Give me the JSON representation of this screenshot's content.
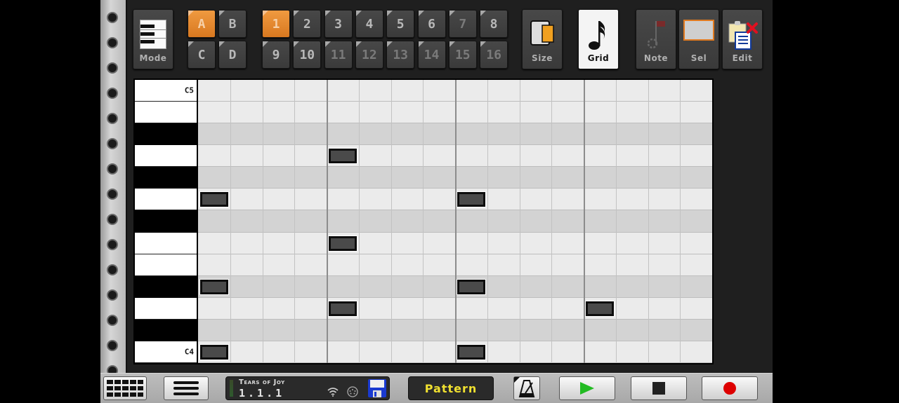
{
  "toolbar": {
    "mode": {
      "label": "Mode",
      "icon": "piano-keys-icon"
    },
    "banks": [
      {
        "label": "A",
        "active": true
      },
      {
        "label": "B",
        "active": false
      },
      {
        "label": "C",
        "active": false
      },
      {
        "label": "D",
        "active": false
      }
    ],
    "patterns": [
      {
        "label": "1",
        "active": true
      },
      {
        "label": "2"
      },
      {
        "label": "3"
      },
      {
        "label": "4"
      },
      {
        "label": "5"
      },
      {
        "label": "6"
      },
      {
        "label": "7",
        "dim": true
      },
      {
        "label": "8"
      },
      {
        "label": "9"
      },
      {
        "label": "10"
      },
      {
        "label": "11",
        "dim": true
      },
      {
        "label": "12",
        "dim": true
      },
      {
        "label": "13",
        "dim": true
      },
      {
        "label": "14",
        "dim": true
      },
      {
        "label": "15",
        "dim": true
      },
      {
        "label": "16",
        "dim": true
      }
    ],
    "tools": [
      {
        "label": "Size",
        "icon": "size-icon",
        "active": false
      },
      {
        "label": "Grid",
        "icon": "eighth-note-icon",
        "active": true
      },
      {
        "label": "Note",
        "icon": "note-flag-icon",
        "active": false
      },
      {
        "label": "Sel",
        "icon": "selection-rect-icon",
        "active": false
      },
      {
        "label": "Edit",
        "icon": "clipboard-edit-icon",
        "active": false
      }
    ]
  },
  "piano_roll": {
    "top_label": "C5",
    "bottom_label": "C4",
    "rows": [
      {
        "note": "C5",
        "type": "white"
      },
      {
        "note": "B4",
        "type": "white"
      },
      {
        "note": "A#4",
        "type": "black"
      },
      {
        "note": "A4",
        "type": "white"
      },
      {
        "note": "G#4",
        "type": "black"
      },
      {
        "note": "G4",
        "type": "white"
      },
      {
        "note": "F#4",
        "type": "black"
      },
      {
        "note": "F4",
        "type": "white"
      },
      {
        "note": "E4",
        "type": "white"
      },
      {
        "note": "D#4",
        "type": "black"
      },
      {
        "note": "D4",
        "type": "white"
      },
      {
        "note": "C#4",
        "type": "black"
      },
      {
        "note": "C4",
        "type": "white"
      }
    ],
    "steps": 16,
    "steps_per_beat": 4,
    "notes": [
      {
        "row": 3,
        "step": 4
      },
      {
        "row": 5,
        "step": 0
      },
      {
        "row": 5,
        "step": 8
      },
      {
        "row": 7,
        "step": 4
      },
      {
        "row": 9,
        "step": 0
      },
      {
        "row": 9,
        "step": 8
      },
      {
        "row": 10,
        "step": 4
      },
      {
        "row": 10,
        "step": 12
      },
      {
        "row": 12,
        "step": 0
      },
      {
        "row": 12,
        "step": 8
      }
    ]
  },
  "bottom": {
    "song_title": "Tears of Joy",
    "position": "1.1.1",
    "mode_label": "Pattern",
    "accent_yellow": "#f0e030",
    "play_color": "#22bb22",
    "record_color": "#dd0000"
  }
}
